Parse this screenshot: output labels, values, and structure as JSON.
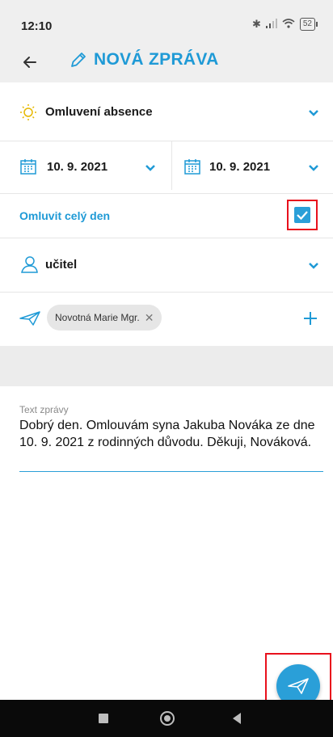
{
  "status_bar": {
    "time": "12:10",
    "battery": "52"
  },
  "app_bar": {
    "title": "NOVÁ ZPRÁVA"
  },
  "form": {
    "type_label": "Omluvení absence",
    "date_from": "10. 9. 2021",
    "date_to": "10. 9. 2021",
    "whole_day_label": "Omluvit celý den",
    "whole_day_checked": true,
    "recipient_role": "učitel",
    "recipient_name": "Novotná Marie Mgr."
  },
  "message": {
    "label": "Text zprávy",
    "text": "Dobrý den. Omlouvám syna Jakuba Nováka ze dne 10. 9. 2021 z rodinných důvodu. Děkuji, Nováková."
  },
  "colors": {
    "accent": "#2a9fd8",
    "highlight": "#e8101c"
  }
}
